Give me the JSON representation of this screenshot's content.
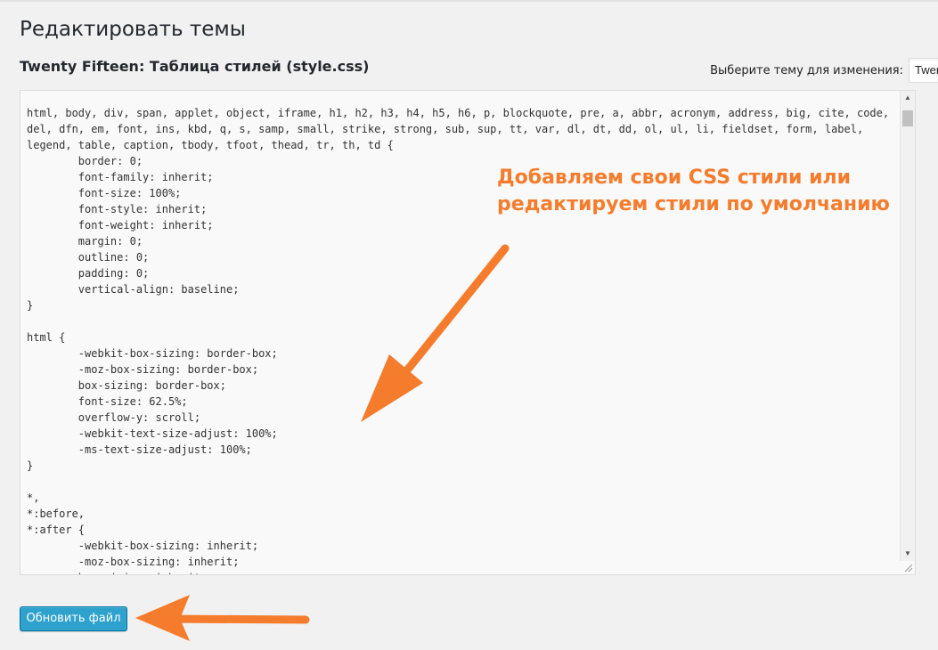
{
  "page": {
    "title": "Редактировать темы",
    "file_title": "Twenty Fifteen: Таблица стилей (style.css)"
  },
  "theme_selector": {
    "label": "Выберите тему для изменения:",
    "selected": "Twenty Fifteen"
  },
  "editor": {
    "content": "html, body, div, span, applet, object, iframe, h1, h2, h3, h4, h5, h6, p, blockquote, pre, a, abbr, acronym, address, big, cite, code,\ndel, dfn, em, font, ins, kbd, q, s, samp, small, strike, strong, sub, sup, tt, var, dl, dt, dd, ol, ul, li, fieldset, form, label,\nlegend, table, caption, tbody, tfoot, thead, tr, th, td {\n\tborder: 0;\n\tfont-family: inherit;\n\tfont-size: 100%;\n\tfont-style: inherit;\n\tfont-weight: inherit;\n\tmargin: 0;\n\toutline: 0;\n\tpadding: 0;\n\tvertical-align: baseline;\n}\n\nhtml {\n\t-webkit-box-sizing: border-box;\n\t-moz-box-sizing: border-box;\n\tbox-sizing: border-box;\n\tfont-size: 62.5%;\n\toverflow-y: scroll;\n\t-webkit-text-size-adjust: 100%;\n\t-ms-text-size-adjust: 100%;\n}\n\n*,\n*:before,\n*:after {\n\t-webkit-box-sizing: inherit;\n\t-moz-box-sizing: inherit;\n\tbox-sizing: inherit;"
  },
  "annotation": {
    "line1": "Добавляем свои CSS стили или",
    "line2": "редактируем стили по умолчанию",
    "color": "#f47c2c"
  },
  "actions": {
    "update_label": "Обновить файл"
  },
  "colors": {
    "button": "#2ea2cc",
    "arrow": "#f47c2c",
    "background": "#f1f1f1"
  },
  "icons": {
    "scroll_up": "triangle-up",
    "scroll_down": "triangle-down",
    "resize": "resize-grip"
  }
}
